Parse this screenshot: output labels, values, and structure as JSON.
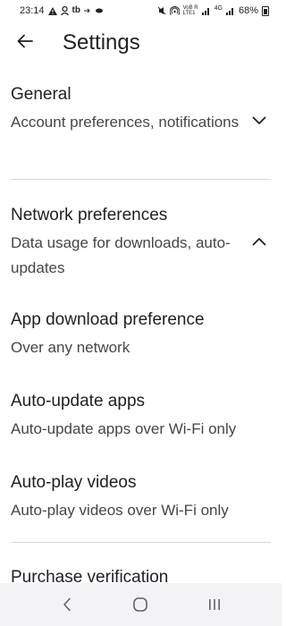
{
  "status_bar": {
    "time": "23:14",
    "left_icons": [
      "warning-icon",
      "account-icon",
      "tb-icon",
      "arrow-icon",
      "dot-icon"
    ],
    "tb_text": "tb",
    "signal_text_1": "VoB R",
    "signal_text_2": "LTE1",
    "network_type": "4G",
    "battery": "68%"
  },
  "app_bar": {
    "back_icon": "arrow-back-icon",
    "title": "Settings"
  },
  "sections": {
    "general": {
      "title": "General",
      "subtitle": "Account preferences, notifications",
      "state": "collapsed"
    },
    "network": {
      "title": "Network preferences",
      "subtitle": "Data usage for downloads, auto-updates",
      "state": "expanded",
      "items": [
        {
          "title": "App download preference",
          "subtitle": "Over any network"
        },
        {
          "title": "Auto-update apps",
          "subtitle": "Auto-update apps over Wi-Fi only"
        },
        {
          "title": "Auto-play videos",
          "subtitle": "Auto-play videos over Wi-Fi only"
        }
      ]
    },
    "purchase": {
      "title": "Purchase verification"
    }
  },
  "nav_bar": {
    "buttons": [
      "back-nav-icon",
      "home-nav-icon",
      "recent-apps-icon"
    ]
  },
  "colors": {
    "background": "#ffffff",
    "text_primary": "#202124",
    "text_secondary": "#444746",
    "divider": "#d6d6d6",
    "nav_background": "#f3f3f5"
  }
}
